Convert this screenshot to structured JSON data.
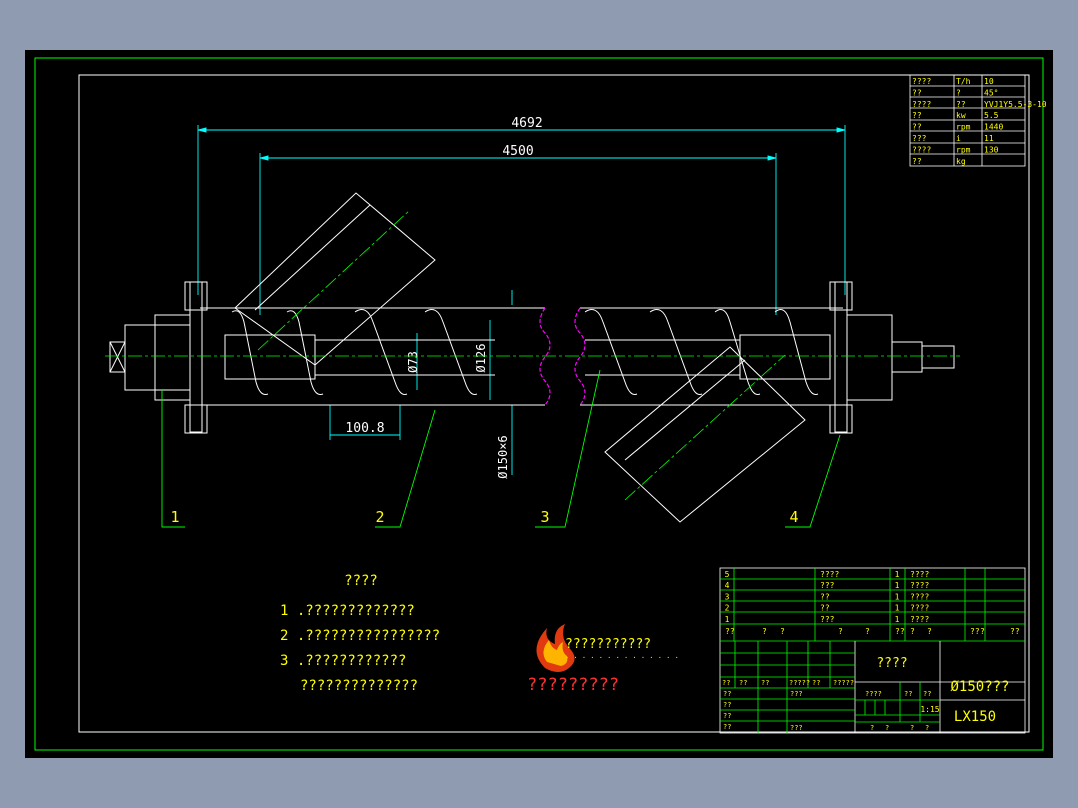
{
  "dimensions": {
    "overall_length": "4692",
    "inner_length": "4500",
    "pitch": "100.8",
    "shaft_diameter": "Ø73",
    "flight_diameter": "Ø126",
    "tube_diameter": "Ø150×6"
  },
  "part_labels": [
    "1",
    "2",
    "3",
    "4"
  ],
  "spec_table": {
    "rows": [
      [
        "????",
        "T/h",
        "10"
      ],
      [
        "??",
        "?",
        "45°"
      ],
      [
        "????",
        "??",
        "YVJ1Y5.5-3-10"
      ],
      [
        "??",
        "kw",
        "5.5"
      ],
      [
        "??",
        "rpm",
        "1440"
      ],
      [
        "???",
        "i",
        "11"
      ],
      [
        "????",
        "rpm",
        "130"
      ],
      [
        "??",
        "kg",
        ""
      ]
    ]
  },
  "notes": {
    "title": "????",
    "items": [
      "1 .?????????????",
      "2 .????????????????",
      "3 .????????????",
      "??????????????"
    ]
  },
  "watermark": {
    "line1": "???????????",
    "dots": "· · · · · · · · · · · · · ·",
    "line2": "?????????"
  },
  "title_block": {
    "parts": [
      {
        "no": "5",
        "code": "",
        "name": "????",
        "qty": "1",
        "mat": "????"
      },
      {
        "no": "4",
        "code": "",
        "name": "???",
        "qty": "1",
        "mat": "????"
      },
      {
        "no": "3",
        "code": "",
        "name": "??",
        "qty": "1",
        "mat": "????"
      },
      {
        "no": "2",
        "code": "",
        "name": "??",
        "qty": "1",
        "mat": "????"
      },
      {
        "no": "1",
        "code": "",
        "name": "???",
        "qty": "1",
        "mat": "????"
      }
    ],
    "header_row": [
      "??",
      "?",
      "?",
      "?",
      "?",
      "??",
      "?",
      "?",
      "??",
      "?",
      "??"
    ],
    "company": "????",
    "drawing_name": "Ø150???",
    "drawing_code": "LX150",
    "row_labels": [
      "??",
      "??",
      "??",
      "?????",
      "??",
      "?????"
    ],
    "left_col": [
      "??",
      "??",
      "??",
      "??"
    ],
    "extra1": "???",
    "extra2": "???",
    "scale_labels": [
      "????",
      "??",
      "??"
    ],
    "scale_value": "1:15",
    "sheet_labels": [
      "?",
      "?",
      "?",
      "?"
    ]
  },
  "colors": {
    "background": "#8e9bb0",
    "paper": "#000000",
    "frame": "#ffffff",
    "outer_frame": "#00ff00",
    "dimension": "#00ffff",
    "leader": "#00ff00",
    "text": "#ffff00",
    "break_line": "#ff00ff"
  }
}
